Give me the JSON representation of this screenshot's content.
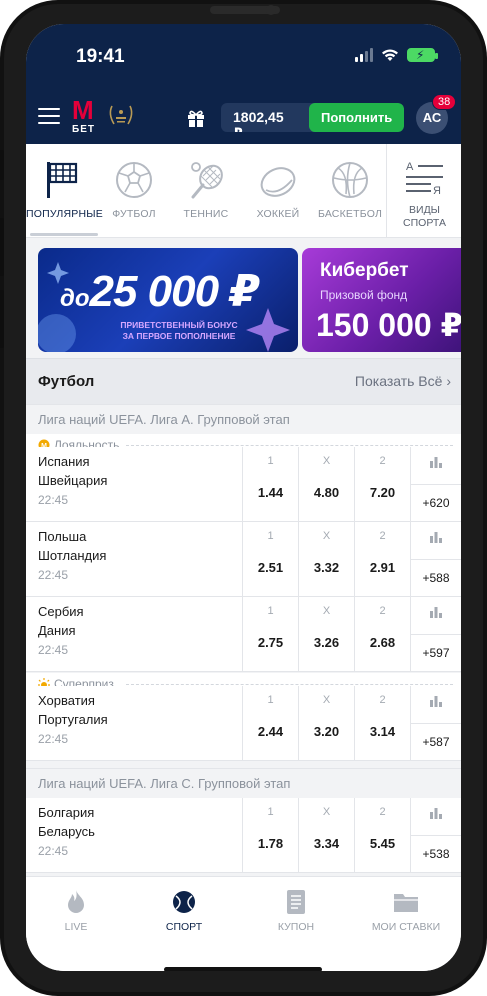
{
  "status_bar": {
    "time": "19:41",
    "battery": "⚡"
  },
  "header": {
    "logo_letter": "M",
    "logo_text": "БЕТ",
    "balance": "1802,45 ₽",
    "topup_label": "Пополнить",
    "avatar_initials": "АС",
    "notifications": "38"
  },
  "sports_tabs": [
    {
      "label": "ПОПУЛЯРНЫЕ",
      "icon": "flag-icon",
      "active": true
    },
    {
      "label": "ФУТБОЛ",
      "icon": "soccer-ball-icon"
    },
    {
      "label": "ТЕННИС",
      "icon": "tennis-racket-icon"
    },
    {
      "label": "ХОККЕЙ",
      "icon": "hockey-puck-icon"
    },
    {
      "label": "БАСКЕТБОЛ",
      "icon": "basketball-icon"
    }
  ],
  "all_sports": {
    "line1": "ВИДЫ",
    "line2": "СПОРТА",
    "icon": "alphabet-list-icon"
  },
  "banners": {
    "first": {
      "prefix": "до",
      "amount": "25 000 ₽",
      "sub1": "ПРИВЕТСТВЕННЫЙ БОНУС",
      "sub2": "ЗА ПЕРВОЕ ПОПОЛНЕНИЕ"
    },
    "second": {
      "title": "Кибербет",
      "subtitle": "Призовой фонд",
      "amount": "150 000 ₽"
    }
  },
  "section": {
    "title": "Футбол",
    "show_all": "Показать Всё"
  },
  "leagues": {
    "a": "Лига наций UEFA. Лига А. Групповой этап",
    "c": "Лига наций UEFA. Лига C. Групповой этап"
  },
  "tags": {
    "loyalty": "Лояльность",
    "surprise": "Суперприз"
  },
  "odds_labels": {
    "one": "1",
    "x": "X",
    "two": "2"
  },
  "matches": [
    {
      "team_a": "Испания",
      "team_b": "Швейцария",
      "time": "22:45",
      "o1": "1.44",
      "ox": "4.80",
      "o2": "7.20",
      "more": "+620"
    },
    {
      "team_a": "Польша",
      "team_b": "Шотландия",
      "time": "22:45",
      "o1": "2.51",
      "ox": "3.32",
      "o2": "2.91",
      "more": "+588"
    },
    {
      "team_a": "Сербия",
      "team_b": "Дания",
      "time": "22:45",
      "o1": "2.75",
      "ox": "3.26",
      "o2": "2.68",
      "more": "+597"
    },
    {
      "team_a": "Хорватия",
      "team_b": "Португалия",
      "time": "22:45",
      "o1": "2.44",
      "ox": "3.20",
      "o2": "3.14",
      "more": "+587"
    },
    {
      "team_a": "Болгария",
      "team_b": "Беларусь",
      "time": "22:45",
      "o1": "1.78",
      "ox": "3.34",
      "o2": "5.45",
      "more": "+538"
    }
  ],
  "bottom_nav": [
    {
      "label": "LIVE",
      "icon": "flame-icon"
    },
    {
      "label": "СПОРТ",
      "icon": "ball-icon",
      "active": true
    },
    {
      "label": "КУПОН",
      "icon": "coupon-icon"
    },
    {
      "label": "МОИ СТАВКИ",
      "icon": "folder-icon"
    }
  ],
  "colors": {
    "header_bg": "#0d2349",
    "accent_green": "#20b44a",
    "brand_red": "#e4003a"
  }
}
